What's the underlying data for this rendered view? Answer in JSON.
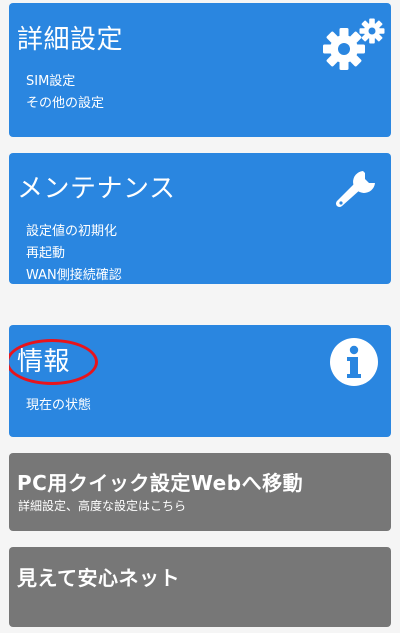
{
  "menu": {
    "detail_settings": {
      "title": "詳細設定",
      "icon": "gears-icon",
      "items": [
        "SIM設定",
        "その他の設定"
      ]
    },
    "maintenance": {
      "title": "メンテナンス",
      "icon": "wrench-icon",
      "items": [
        "設定値の初期化",
        "再起動",
        "WAN側接続確認"
      ]
    },
    "info": {
      "title": "情報",
      "icon": "info-icon",
      "items": [
        "現在の状態"
      ]
    },
    "pc_web": {
      "title": "PC用クイック設定Webへ移動",
      "note": "詳細設定、高度な設定はこちら"
    },
    "anshin_net": {
      "title": "見えて安心ネット"
    }
  },
  "colors": {
    "card_blue": "#2a86e0",
    "card_gray": "#777777",
    "highlight_red": "#e8141c",
    "text": "#ffffff"
  }
}
